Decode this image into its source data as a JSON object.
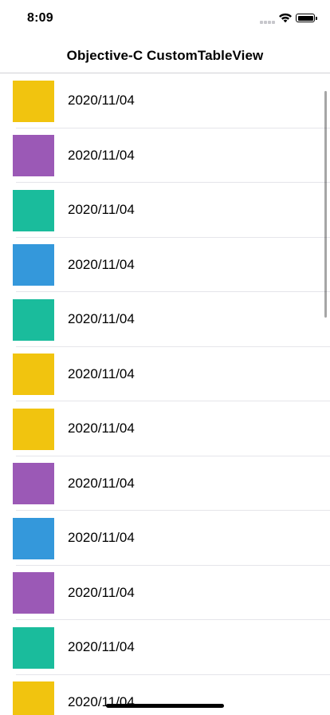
{
  "status_bar": {
    "time": "8:09"
  },
  "nav": {
    "title": "Objective-C CustomTableView"
  },
  "colors": {
    "yellow": "#f1c40f",
    "purple": "#9b59b6",
    "teal": "#1abc9c",
    "blue": "#3498db"
  },
  "rows": [
    {
      "date": "2020/11/04",
      "color": "#f1c40f"
    },
    {
      "date": "2020/11/04",
      "color": "#9b59b6"
    },
    {
      "date": "2020/11/04",
      "color": "#1abc9c"
    },
    {
      "date": "2020/11/04",
      "color": "#3498db"
    },
    {
      "date": "2020/11/04",
      "color": "#1abc9c"
    },
    {
      "date": "2020/11/04",
      "color": "#f1c40f"
    },
    {
      "date": "2020/11/04",
      "color": "#f1c40f"
    },
    {
      "date": "2020/11/04",
      "color": "#9b59b6"
    },
    {
      "date": "2020/11/04",
      "color": "#3498db"
    },
    {
      "date": "2020/11/04",
      "color": "#9b59b6"
    },
    {
      "date": "2020/11/04",
      "color": "#1abc9c"
    },
    {
      "date": "2020/11/04",
      "color": "#f1c40f"
    }
  ]
}
